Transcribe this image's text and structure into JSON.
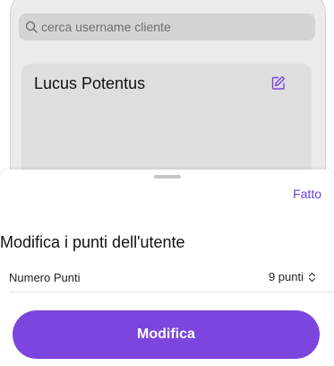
{
  "search": {
    "placeholder": "cerca username cliente"
  },
  "customer_card": {
    "name": "Lucus Potentus"
  },
  "sheet": {
    "done_label": "Fatto",
    "title": "Modifica i punti dell'utente",
    "points_row": {
      "label": "Numero Punti",
      "value": "9 punti"
    },
    "submit_label": "Modifica"
  },
  "colors": {
    "accent": "#7b45de",
    "link": "#6c3fd8"
  },
  "icons": {
    "search": "search-icon",
    "edit": "edit-icon",
    "stepper": "chevron-up-down-icon"
  }
}
